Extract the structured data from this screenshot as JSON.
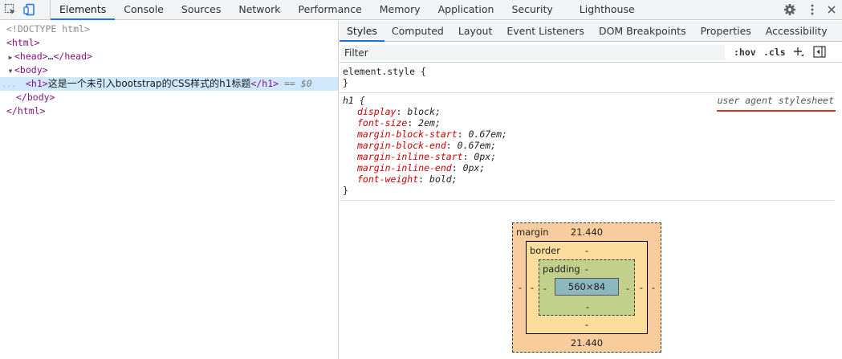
{
  "toolbar": {
    "tabs": [
      "Elements",
      "Console",
      "Sources",
      "Network",
      "Performance",
      "Memory",
      "Application",
      "Security",
      "Lighthouse"
    ],
    "active_tab": "Elements"
  },
  "dom": {
    "doctype": "<!DOCTYPE html>",
    "html_open": "<html>",
    "head_open": "<head>",
    "head_ellipsis": "…",
    "head_close": "</head>",
    "body_open": "<body>",
    "h1_open": "<h1>",
    "h1_text": "这是一个未引入bootstrap的CSS样式的h1标题",
    "h1_close": "</h1>",
    "selected_marker": "== $0",
    "dots": "...",
    "body_close": "</body>",
    "html_close": "</html>"
  },
  "styles": {
    "subtabs": [
      "Styles",
      "Computed",
      "Layout",
      "Event Listeners",
      "DOM Breakpoints",
      "Properties",
      "Accessibility"
    ],
    "active_subtab": "Styles",
    "filter_placeholder": "Filter",
    "hov_label": ":hov",
    "cls_label": ".cls",
    "element_style_selector": "element.style {",
    "close_brace": "}",
    "h1_selector": "h1 {",
    "origin": "user agent stylesheet",
    "declarations": [
      {
        "prop": "display",
        "value": "block;"
      },
      {
        "prop": "font-size",
        "value": "2em;"
      },
      {
        "prop": "margin-block-start",
        "value": "0.67em;"
      },
      {
        "prop": "margin-block-end",
        "value": "0.67em;"
      },
      {
        "prop": "margin-inline-start",
        "value": "0px;"
      },
      {
        "prop": "margin-inline-end",
        "value": "0px;"
      },
      {
        "prop": "font-weight",
        "value": "bold;"
      }
    ]
  },
  "boxmodel": {
    "margin_label": "margin",
    "margin_top": "21.440",
    "margin_bottom": "21.440",
    "margin_left": "-",
    "margin_right": "-",
    "border_label": "border",
    "border_top": "-",
    "border_bottom": "-",
    "border_left": "-",
    "border_right": "-",
    "padding_label": "padding",
    "padding_top": "-",
    "padding_bottom": "-",
    "padding_left": "-",
    "padding_right": "-",
    "content": "560×84"
  },
  "colors": {
    "accent": "#1a73e8",
    "margin": "#f9cc9d",
    "border": "#fddd9b",
    "padding": "#c3d08b",
    "content": "#8cb6c0",
    "underline": "#d93025"
  }
}
